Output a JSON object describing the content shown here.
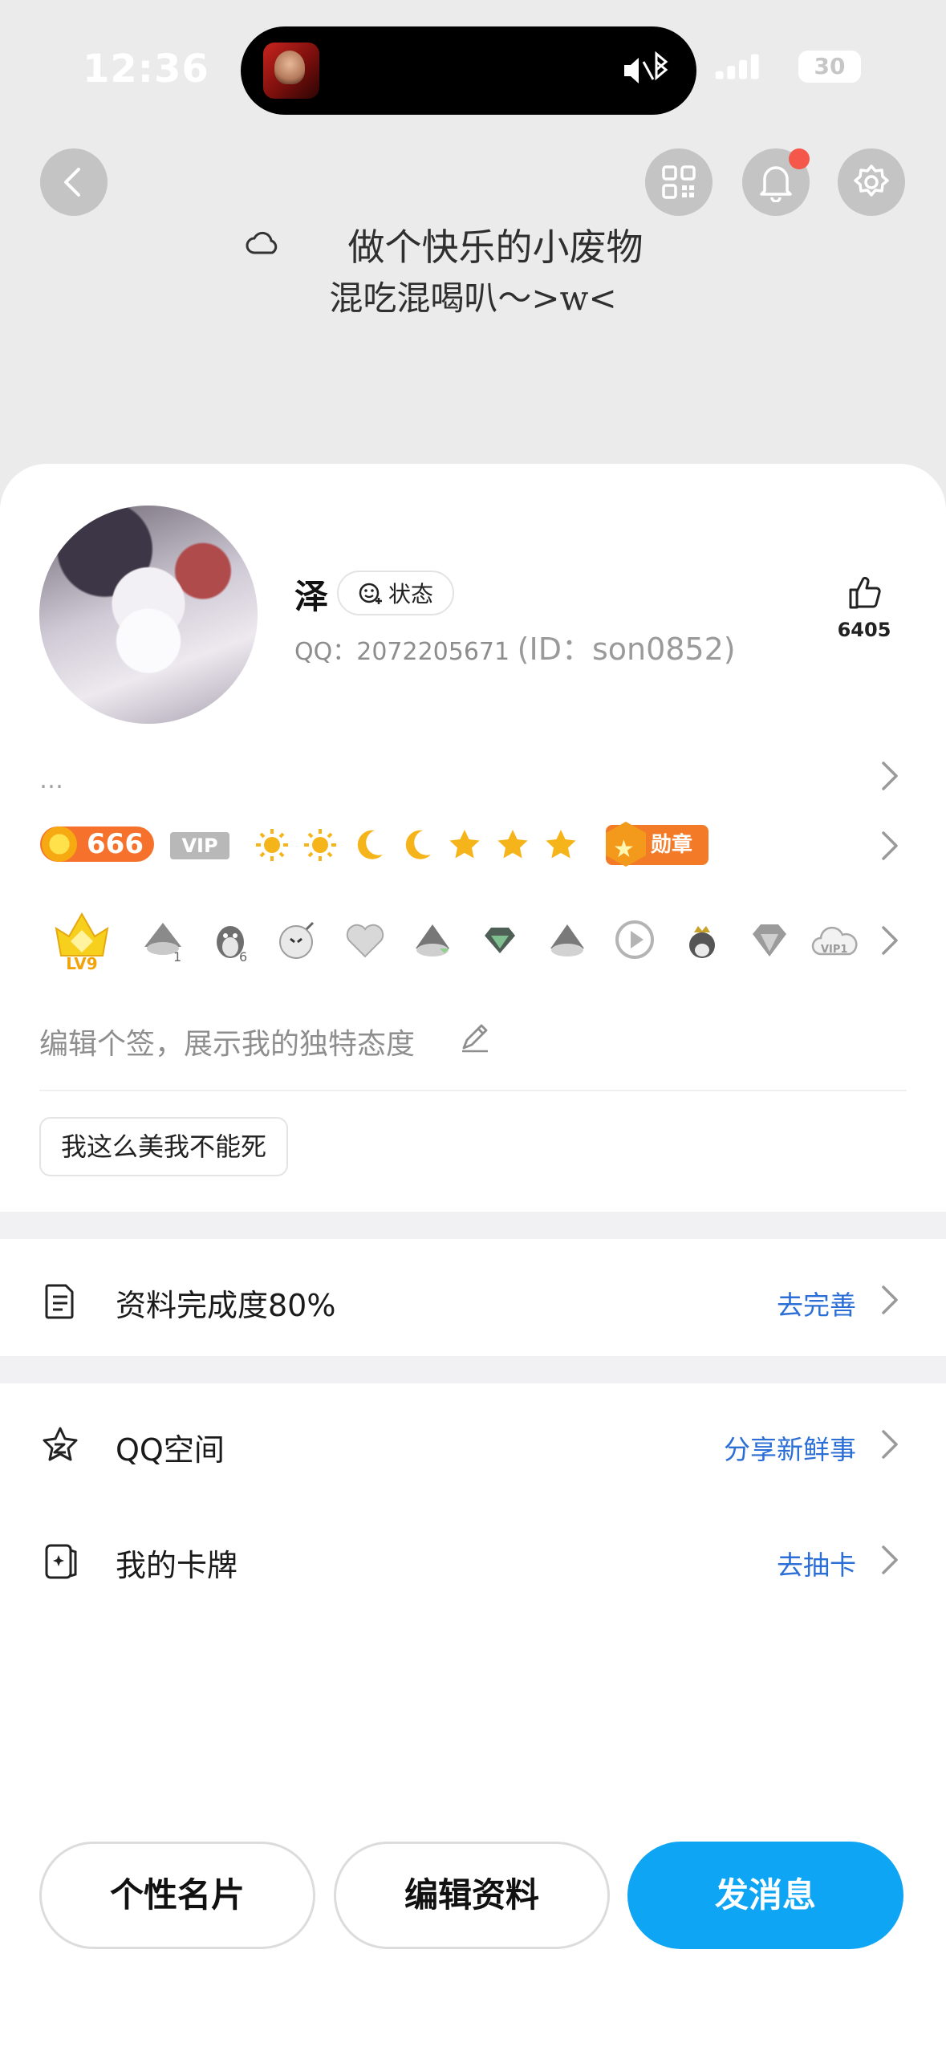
{
  "status_bar": {
    "time": "12:36",
    "battery": "30"
  },
  "header": {
    "bio_line1": "做个快乐的小废物",
    "bio_line2": "混吃混喝叭～>w<"
  },
  "profile": {
    "nickname": "泽",
    "status_label": "状态",
    "qq_label": "QQ：2072205671",
    "id_label": "(ID：son0852)",
    "likes": "6405",
    "ellipsis": "…"
  },
  "levels": {
    "coin_value": "666",
    "vip_label": "VIP",
    "medal_label": "勋章"
  },
  "badges": {
    "level_badge": "LV9",
    "vip_badge": "VIP1",
    "mini_numbers": [
      "1",
      "6"
    ]
  },
  "signature": {
    "placeholder": "编辑个签，展示我的独特态度"
  },
  "tags": [
    "我这么美我不能死"
  ],
  "rows": {
    "profile_completion": {
      "title": "资料完成度80%",
      "action": "去完善",
      "percent": 80
    },
    "qzone": {
      "title": "QQ空间",
      "action": "分享新鲜事"
    },
    "cards": {
      "title": "我的卡牌",
      "action": "去抽卡"
    }
  },
  "buttons": {
    "card": "个性名片",
    "edit": "编辑资料",
    "message": "发消息"
  },
  "colors": {
    "accent": "#0ea5f4",
    "link": "#2b6fd6",
    "coin": "#f6722c",
    "notification_dot": "#f5574a"
  }
}
